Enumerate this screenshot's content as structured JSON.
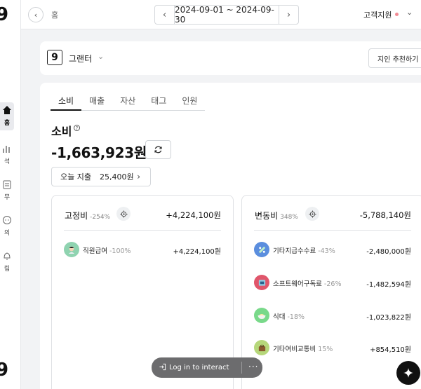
{
  "rail": {
    "logo": "9",
    "items": [
      {
        "label": "홈",
        "icon": "home-icon"
      },
      {
        "label": "석",
        "icon": "chart-icon"
      },
      {
        "label": "무",
        "icon": "ledger-icon"
      },
      {
        "label": "의",
        "icon": "chat-icon"
      },
      {
        "label": "림",
        "icon": "bell-icon"
      }
    ]
  },
  "topbar": {
    "breadcrumb": "홈",
    "date_range": "2024-09-01 ~ 2024-09-30",
    "support_label": "고객지원"
  },
  "company": {
    "logo": "9",
    "name": "그랜터",
    "recommend_label": "지인 추천하기"
  },
  "tabs": [
    {
      "label": "소비",
      "active": true
    },
    {
      "label": "매출",
      "active": false
    },
    {
      "label": "자산",
      "active": false
    },
    {
      "label": "태그",
      "active": false
    },
    {
      "label": "인원",
      "active": false
    }
  ],
  "summary": {
    "title": "소비",
    "help_glyph": "?",
    "total": "-1,663,923원",
    "today_label": "오늘 지출",
    "today_amount": "25,400원"
  },
  "fixed": {
    "title": "고정비",
    "pct": "-254%",
    "total": "+4,224,100원",
    "items": [
      {
        "label": "직원급여",
        "pct": "-100%",
        "amount": "+4,224,100원",
        "icon": "employee-avatar-icon",
        "color": "#8fd3b0"
      }
    ]
  },
  "variable": {
    "title": "변동비",
    "pct": "348%",
    "total": "-5,788,140원",
    "items": [
      {
        "label": "기타지급수수료",
        "pct": "-43%",
        "amount": "-2,480,000원",
        "icon": "fee-icon",
        "color": "#5b8ede"
      },
      {
        "label": "소프트웨어구독료",
        "pct": "-26%",
        "amount": "-1,482,594원",
        "icon": "software-icon",
        "color": "#e0566b"
      },
      {
        "label": "식대",
        "pct": "-18%",
        "amount": "-1,023,822원",
        "icon": "meal-icon",
        "color": "#79d98a"
      },
      {
        "label": "기타여비교통비",
        "pct": "15%",
        "amount": "+854,510원",
        "icon": "travel-bag-icon",
        "color": "#b6d77a"
      }
    ]
  },
  "login_bar": {
    "label": "Log in to interact",
    "more": "···"
  }
}
